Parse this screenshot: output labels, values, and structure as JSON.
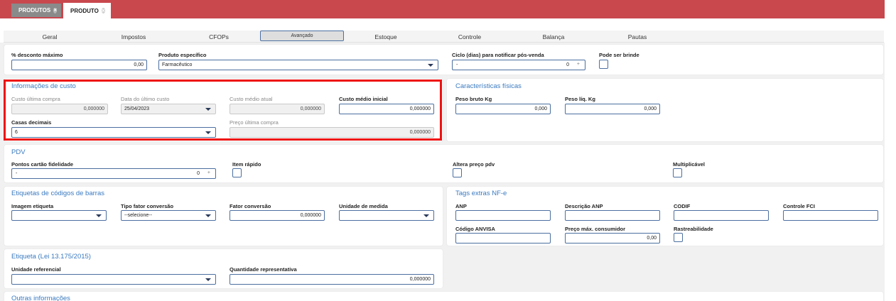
{
  "top_tabs": [
    {
      "label": "PRODUTOS"
    },
    {
      "label": "PRODUTO"
    }
  ],
  "sub_tabs": [
    "Geral",
    "Impostos",
    "CFOPs",
    "Avançado",
    "Estoque",
    "Controle",
    "Balança",
    "Pautas"
  ],
  "general": {
    "desconto_label": "% desconto máximo",
    "desconto_value": "0,00",
    "produto_especifico_label": "Produto específico",
    "produto_especifico_value": "Farmacêutico",
    "ciclo_label": "Ciclo (dias) para notificar pós-venda",
    "ciclo_value_left": "-",
    "ciclo_value": "0",
    "ciclo_plus": "+",
    "brinde_label": "Pode ser brinde"
  },
  "custo": {
    "title": "Informações de custo",
    "ultima_compra_label": "Custo última compra",
    "ultima_compra_value": "0,000000",
    "data_ultimo_label": "Data do último custo",
    "data_ultimo_value": "25/04/2023",
    "medio_atual_label": "Custo médio atual",
    "medio_atual_value": "0,000000",
    "medio_inicial_label": "Custo médio inicial",
    "medio_inicial_value": "0,000000",
    "casas_label": "Casas decimais",
    "casas_value": "6",
    "preco_ultima_label": "Preço última compra",
    "preco_ultima_value": "0,000000"
  },
  "fisicas": {
    "title": "Características físicas",
    "peso_bruto_label": "Peso bruto Kg",
    "peso_bruto_value": "0,000",
    "peso_liq_label": "Peso líq. Kg",
    "peso_liq_value": "0,000"
  },
  "pdv": {
    "title": "PDV",
    "pontos_label": "Pontos cartão fidelidade",
    "pontos_left": "-",
    "pontos_value": "0",
    "pontos_plus": "+",
    "item_rapido_label": "Item rápido",
    "altera_preco_label": "Altera preço pdv",
    "multiplicavel_label": "Multiplicável"
  },
  "etiquetas": {
    "title": "Etiquetas de códigos de barras",
    "imagem_label": "Imagem etiqueta",
    "tipo_fator_label": "Tipo fator conversão",
    "tipo_fator_value": "--selecione--",
    "fator_label": "Fator conversão",
    "fator_value": "0,000000",
    "unidade_label": "Unidade de medida"
  },
  "tags": {
    "title": "Tags extras NF-e",
    "anp_label": "ANP",
    "descricao_anp_label": "Descrição ANP",
    "codif_label": "CODIF",
    "controle_fci_label": "Controle FCI",
    "anvisa_label": "Código ANVISA",
    "preco_max_label": "Preço máx. consumidor",
    "preco_max_value": "0,00",
    "rastreabilidade_label": "Rastreabilidade"
  },
  "etiqueta_lei": {
    "title": "Etiqueta (Lei 13.175/2015)",
    "unidade_ref_label": "Unidade referencial",
    "quantidade_label": "Quantidade representativa",
    "quantidade_value": "0,000000"
  },
  "outras": {
    "title": "Outras informações"
  },
  "colors": {
    "topbar": "#c8484e",
    "accent": "#3a7ac0",
    "highlight": "#e11111"
  }
}
